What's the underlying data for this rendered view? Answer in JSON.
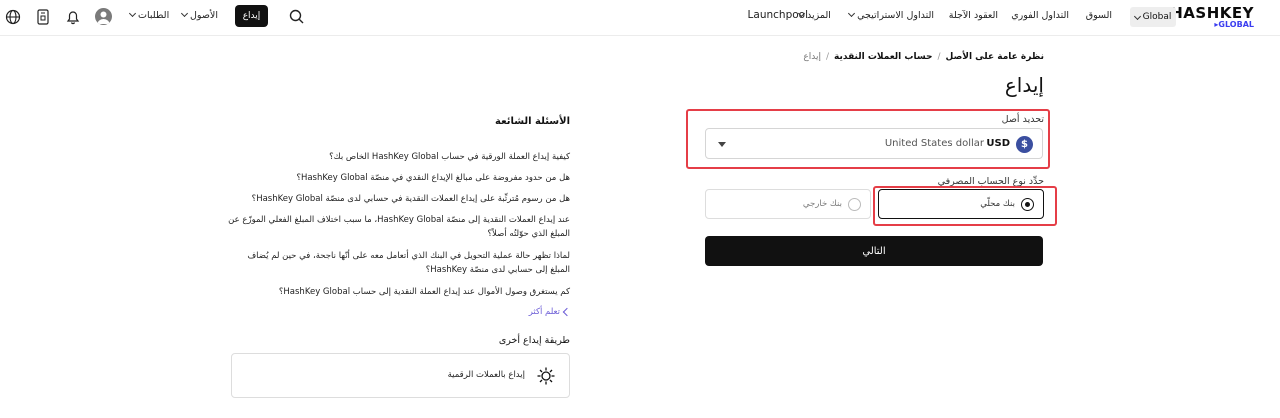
{
  "header": {
    "logo_main": "HASHKEY",
    "logo_sub": "GLOBAL",
    "region": "Global",
    "nav": {
      "market": "السوق",
      "spot": "التداول الفوري",
      "futures": "العقود الآجلة",
      "strategy": "التداول الاستراتيجي",
      "launchpool": "Launchpool",
      "more": "المزيد"
    },
    "deposit_button": "إيداع",
    "assets_menu": "الأصول",
    "orders_menu": "الطلبات"
  },
  "breadcrumb": {
    "overview": "نظرة عامة على الأصل",
    "fiat_account": "حساب العملات النقدية",
    "current": "إيداع"
  },
  "page_title": "إيداع",
  "asset_select": {
    "label": "تحديد أصل",
    "code": "USD",
    "name": "United States dollar"
  },
  "account_type": {
    "label": "حدِّد نوع الحساب المصرفي",
    "local": "بنك محلّي",
    "foreign": "بنك خارجي"
  },
  "next_button": "التالي",
  "faq": {
    "title": "الأسئلة الشائعة",
    "items": [
      "كيفية إيداع العملة الورقية في حساب HashKey Global الخاص بك؟",
      "هل من حدود مفروضة على مبالغ الإيداع النقدي في منصّة HashKey Global؟",
      "هل من رسوم مُترتِّبة على إيداع العملات النقدية في حسابي لدى منصّة HashKey Global؟",
      "عند إيداع العملات النقدية إلى منصّة HashKey Global، ما سبب اختلاف المبلغ الفعلي الموزّع عن المبلغ الذي حوّلتُه أصلاً؟",
      "لماذا تظهر حالة عملية التحويل في البنك الذي أتعامل معه على أنّها ناجحة، في حين لم يُضاف المبلغ إلى حسابي لدى منصّة HashKey؟",
      "كم يستغرق وصول الأموال عند إيداع العملة النقدية إلى حساب HashKey Global؟"
    ],
    "learn_more": "تعلم أكثر"
  },
  "other_methods": {
    "title": "طريقة إيداع أخرى",
    "crypto": "إيداع بالعملات الرقمية"
  },
  "colors": {
    "highlight": "#e53e47",
    "brand_blue": "#3a3df0",
    "link": "#6b5cd6",
    "primary": "#111111"
  }
}
